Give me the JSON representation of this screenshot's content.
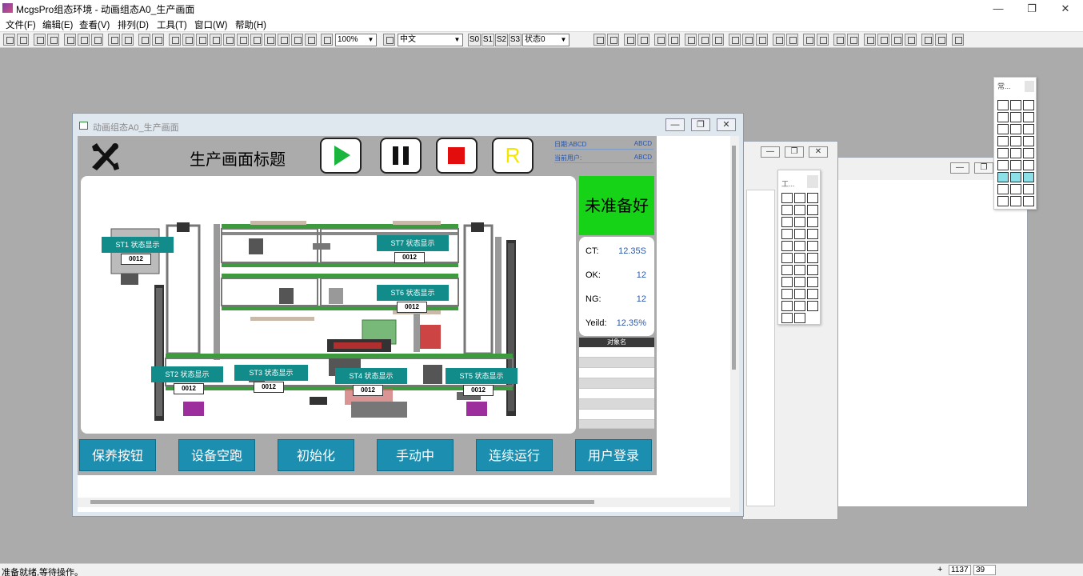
{
  "app": {
    "title": "McgsPro组态环境 - 动画组态A0_生产画面"
  },
  "menu": [
    "文件(F)",
    "编辑(E)",
    "查看(V)",
    "排列(D)",
    "工具(T)",
    "窗口(W)",
    "帮助(H)"
  ],
  "toolbar": {
    "zoom": "100%",
    "language": "中文",
    "state_buttons": [
      "S0",
      "S1",
      "S2",
      "S3"
    ],
    "state_select": "状态0"
  },
  "window": {
    "title": "动画组态A0_生产画面"
  },
  "hmi": {
    "title": "生产画面标题",
    "user_info": {
      "date_label": "日期:ABCD",
      "date_value": "ABCD",
      "user_label": "当前用户:",
      "user_value": "ABCD"
    },
    "control_buttons": {
      "reset_label": "R"
    },
    "status": "未准备好",
    "stats": [
      {
        "label": "CT:",
        "value": "12.35S"
      },
      {
        "label": "OK:",
        "value": "12"
      },
      {
        "label": "NG:",
        "value": "12"
      },
      {
        "label": "Yeild:",
        "value": "12.35%"
      }
    ],
    "object_table_header": "对象名",
    "stations": [
      {
        "label": "ST1 状态显示",
        "count": "0012"
      },
      {
        "label": "ST7 状态显示",
        "count": "0012"
      },
      {
        "label": "ST6 状态显示",
        "count": "0012"
      },
      {
        "label": "ST2 状态显示",
        "count": "0012"
      },
      {
        "label": "ST3 状态显示",
        "count": "0012"
      },
      {
        "label": "ST4 状态显示",
        "count": "0012"
      },
      {
        "label": "ST5 状态显示",
        "count": "0012"
      }
    ],
    "bottom_buttons": [
      "保养按钮",
      "设备空跑",
      "初始化",
      "手动中",
      "连续运行",
      "用户登录"
    ]
  },
  "palettes": {
    "common_title": "常...",
    "tools_title": "工..."
  },
  "statusbar": {
    "text": "准备就绪,等待操作。",
    "coord_x": "1137",
    "coord_y": "39"
  },
  "colors": {
    "accent_teal": "#1c8fb0",
    "station_teal": "#128c8a",
    "ready_green": "#17d317",
    "stat_blue": "#2e5aa8"
  }
}
